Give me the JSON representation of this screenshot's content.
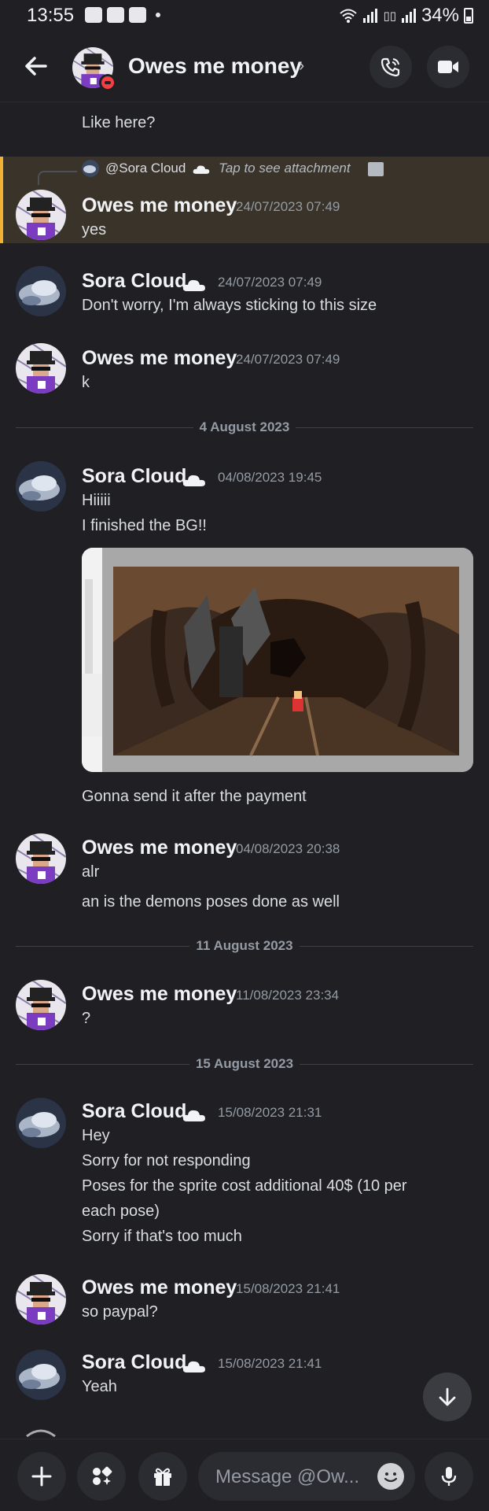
{
  "status_bar": {
    "time": "13:55",
    "battery": "34%"
  },
  "header": {
    "title": "Owes me money",
    "chevron": "›"
  },
  "top_partial_text": "Like here?",
  "reply": {
    "name": "@Sora Cloud",
    "text": "Tap to see attachment"
  },
  "messages": [
    {
      "author": "Owes me money",
      "timestamp": "24/07/2023 07:49",
      "lines": [
        "yes"
      ]
    },
    {
      "author": "Sora Cloud",
      "timestamp": "24/07/2023 07:49",
      "lines": [
        "Don't worry, I'm always sticking to this size"
      ]
    },
    {
      "author": "Owes me money",
      "timestamp": "24/07/2023 07:49",
      "lines": [
        "k"
      ]
    },
    {
      "author": "Sora Cloud",
      "timestamp": "04/08/2023 19:45",
      "lines": [
        "Hiiiii",
        "I finished the BG!!"
      ]
    },
    {
      "lines": [
        "Gonna send it after the payment"
      ]
    },
    {
      "author": "Owes me money",
      "timestamp": "04/08/2023 20:38",
      "lines": [
        "alr",
        "an is the demons poses done as well"
      ]
    },
    {
      "author": "Owes me money",
      "timestamp": "11/08/2023 23:34",
      "lines": [
        "?"
      ]
    },
    {
      "author": "Sora Cloud",
      "timestamp": "15/08/2023 21:31",
      "lines": [
        "Hey",
        "Sorry for not responding",
        "Poses for the sprite cost additional 40$ (10 per",
        "each pose)",
        "Sorry if that's too much"
      ]
    },
    {
      "author": "Owes me money",
      "timestamp": "15/08/2023 21:41",
      "lines": [
        "so paypal?"
      ]
    },
    {
      "author": "Sora Cloud",
      "timestamp": "15/08/2023 21:41",
      "lines": [
        "Yeah"
      ]
    }
  ],
  "dividers": [
    "4 August 2023",
    "11 August 2023",
    "15 August 2023"
  ],
  "composer": {
    "placeholder": "Message @Ow..."
  },
  "colors": {
    "background": "#1f1f24",
    "highlight": "#3a332a",
    "highlight_bar": "#f0b232",
    "dnd": "#f23f43"
  }
}
